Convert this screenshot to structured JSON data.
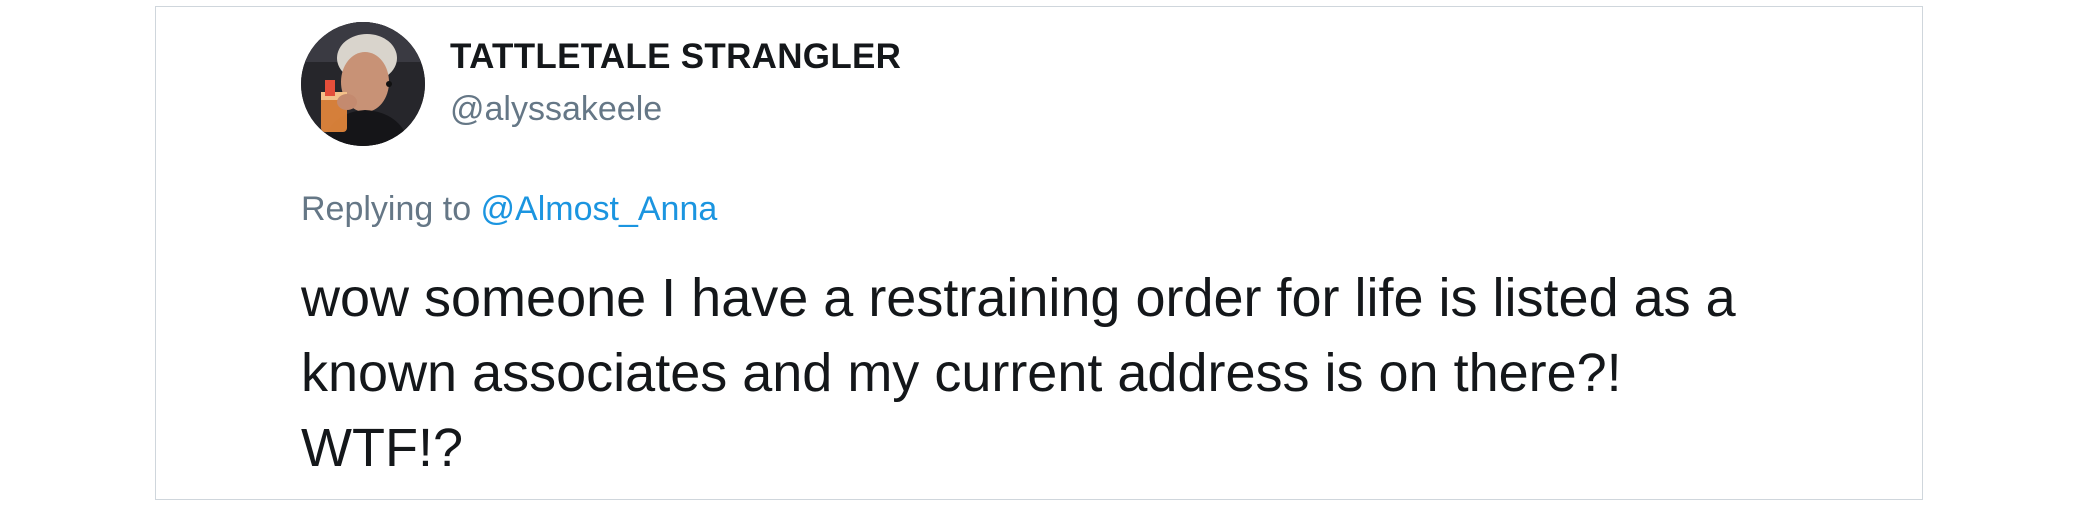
{
  "tweet": {
    "display_name": "TATTLETALE STRANGLER",
    "handle": "@alyssakeele",
    "replying_prefix": "Replying to",
    "replying_to": "@Almost_Anna",
    "text": "wow someone I have a restraining order for life is listed as a known associates and my current address is on there?! WTF!?",
    "avatar_icon": "profile-photo"
  },
  "colors": {
    "text_primary": "#14171a",
    "text_secondary": "#657786",
    "link": "#1b95e0",
    "border": "#cfd6dc"
  }
}
